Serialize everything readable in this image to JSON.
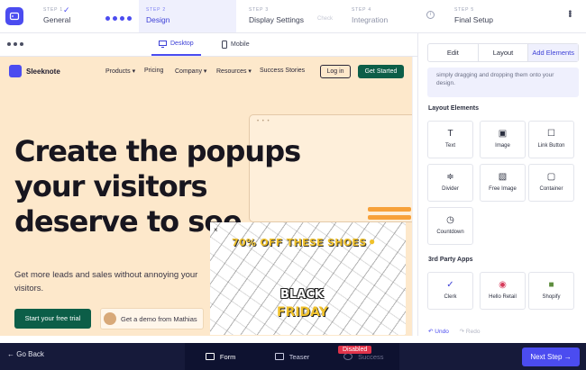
{
  "stepper": {
    "steps": [
      {
        "num": "STEP 1",
        "name": "General"
      },
      {
        "num": "STEP 2",
        "name": "Design"
      },
      {
        "num": "STEP 3",
        "name": "Display Settings"
      },
      {
        "num": "STEP 4",
        "name": "Integration"
      },
      {
        "num": "STEP 5",
        "name": "Final Setup"
      }
    ],
    "ghost_check": "Check",
    "info": "i"
  },
  "preview": {
    "tabs": [
      "Desktop",
      "Mobile"
    ]
  },
  "site": {
    "brand": "Sleeknote",
    "nav": [
      "Products ▾",
      "Pricing",
      "Company ▾",
      "Resources ▾",
      "Success Stories"
    ],
    "login": "Log in",
    "get_started": "Get Started",
    "hero_title": "Create the popups your visitors deserve to see",
    "hero_sub": "Get more leads and sales without annoying your visitors.",
    "trial_cta": "Start your free trial",
    "demo_cta": "Get a demo from Mathias"
  },
  "popup": {
    "headline": "70% OFF THESE SHOES",
    "black": "BLACK",
    "friday": "FRIDAY",
    "close": "×"
  },
  "panel": {
    "tabs": [
      "Edit",
      "Layout",
      "Add Elements"
    ],
    "hint": "simply dragging and dropping them onto your design.",
    "layout_label": "Layout Elements",
    "layout_elements": [
      "Text",
      "Image",
      "Link Button",
      "Divider",
      "Free Image",
      "Container",
      "Countdown"
    ],
    "apps_label": "3rd Party Apps",
    "apps": [
      "Clerk",
      "Hello Retail",
      "Shopify"
    ],
    "undo": "Undo",
    "redo": "Redo"
  },
  "bottom": {
    "back": "Go Back",
    "tabs": [
      "Form",
      "Teaser",
      "Success"
    ],
    "disabled_badge": "Disabled",
    "next": "Next Step"
  },
  "colors": {
    "accent": "#4b4cf0",
    "site_bg": "#fde8cb",
    "site_green": "#0c5e48",
    "bottom_bar": "#161a3a",
    "badge_red": "#e0334a"
  }
}
